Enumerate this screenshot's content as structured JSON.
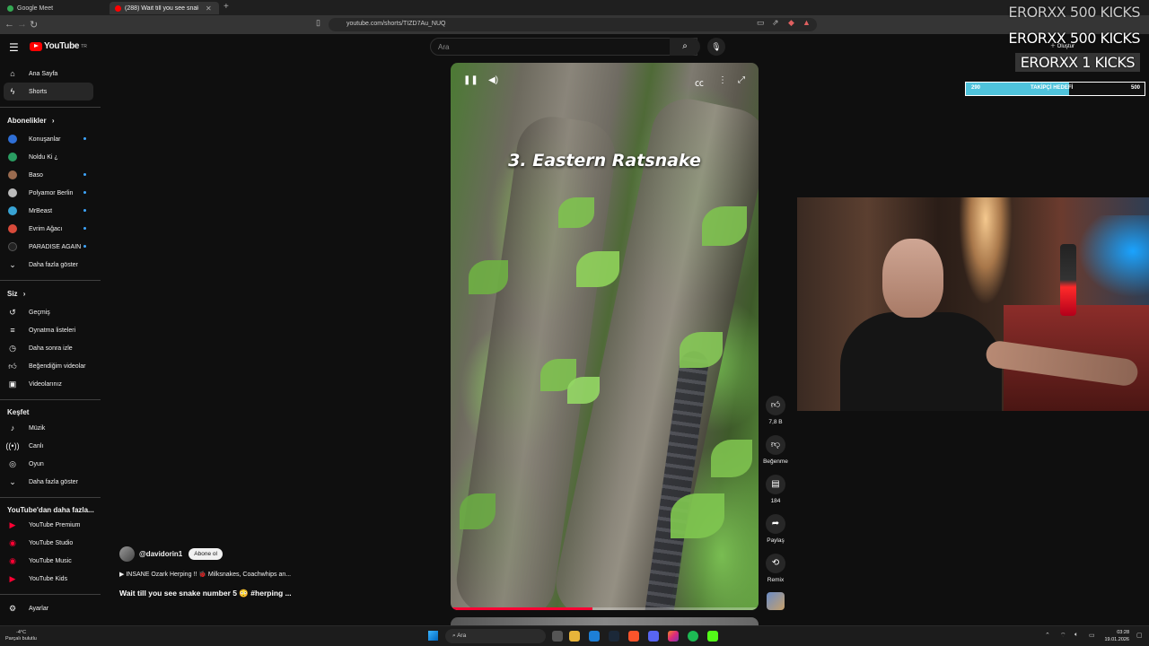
{
  "browser": {
    "tabs": [
      {
        "title": "Google Meet"
      },
      {
        "title": "(288) Wait till you see snake ..."
      }
    ],
    "url": "youtube.com/shorts/TIZD7Au_NUQ"
  },
  "header": {
    "logo_text": "YouTube",
    "logo_sup": "TR",
    "search_placeholder": "Ara"
  },
  "sidebar": {
    "main": [
      {
        "label": "Ana Sayfa",
        "icon": "home-icon"
      },
      {
        "label": "Shorts",
        "icon": "shorts-icon"
      }
    ],
    "subscriptions_heading": "Abonelikler",
    "subscriptions": [
      {
        "label": "Konuşanlar",
        "color": "#2f6fd6",
        "dot": true
      },
      {
        "label": "Noldu Ki ¿",
        "color": "#2a9d62",
        "dot": false
      },
      {
        "label": "Baso",
        "color": "#9a6b4f",
        "dot": true
      },
      {
        "label": "Polyamor Berlin",
        "color": "#bbbbbb",
        "dot": true
      },
      {
        "label": "MrBeast",
        "color": "#38a3d4",
        "dot": true
      },
      {
        "label": "Evrim Ağacı",
        "color": "#d84a3a",
        "dot": true
      },
      {
        "label": "PARADISE AGAIN",
        "color": "#222222",
        "dot": true
      }
    ],
    "subscriptions_more": "Daha fazla göster",
    "you_heading": "Siz",
    "you": [
      {
        "label": "Geçmiş",
        "icon": "history-icon"
      },
      {
        "label": "Oynatma listeleri",
        "icon": "playlists-icon"
      },
      {
        "label": "Daha sonra izle",
        "icon": "watch-later-icon"
      },
      {
        "label": "Beğendiğim videolar",
        "icon": "liked-icon"
      },
      {
        "label": "Videolarınız",
        "icon": "your-videos-icon"
      }
    ],
    "explore_heading": "Keşfet",
    "explore": [
      {
        "label": "Müzik",
        "icon": "music-icon"
      },
      {
        "label": "Canlı",
        "icon": "live-icon"
      },
      {
        "label": "Oyun",
        "icon": "gaming-icon"
      }
    ],
    "explore_more": "Daha fazla göster",
    "more_heading": "YouTube'dan daha fazla...",
    "more": [
      {
        "label": "YouTube Premium"
      },
      {
        "label": "YouTube Studio"
      },
      {
        "label": "YouTube Music"
      },
      {
        "label": "YouTube Kids"
      }
    ],
    "settings": "Ayarlar"
  },
  "short": {
    "overlay_title": "3. Eastern Ratsnake",
    "progress": 0.46,
    "channel": "@davidorin1",
    "subscribe_label": "Abone ol",
    "song": "INSANE Ozark Herping !! 🐞 Milksnakes, Coachwhips an...",
    "title": "Wait till you see snake number 5 😳 #herping ..."
  },
  "actions": [
    {
      "name": "like",
      "icon": "thumbs-up-icon",
      "label": "7,8 B"
    },
    {
      "name": "dislike",
      "icon": "thumbs-down-icon",
      "label": "Beğenme"
    },
    {
      "name": "comments",
      "icon": "comment-icon",
      "label": "184"
    },
    {
      "name": "share",
      "icon": "share-icon",
      "label": "Paylaş"
    },
    {
      "name": "remix",
      "icon": "remix-icon",
      "label": "Remix"
    }
  ],
  "overlay": {
    "kicks_1": "ERORXX  500 KICKS",
    "kicks_2": "ERORXX  500 KICKS",
    "kicks_3": "ERORXX  1 KICKS",
    "goal_current": "290",
    "goal_label": "TAKİPÇİ HEDEFİ",
    "goal_target": "500",
    "goal_progress": 0.58,
    "create_label": "Oluştur"
  },
  "taskbar": {
    "weather_temp": "-4°C",
    "weather_desc": "Parçalı bulutlu",
    "search_placeholder": "Ara",
    "time": "03:28",
    "date": "19.01.2026"
  }
}
